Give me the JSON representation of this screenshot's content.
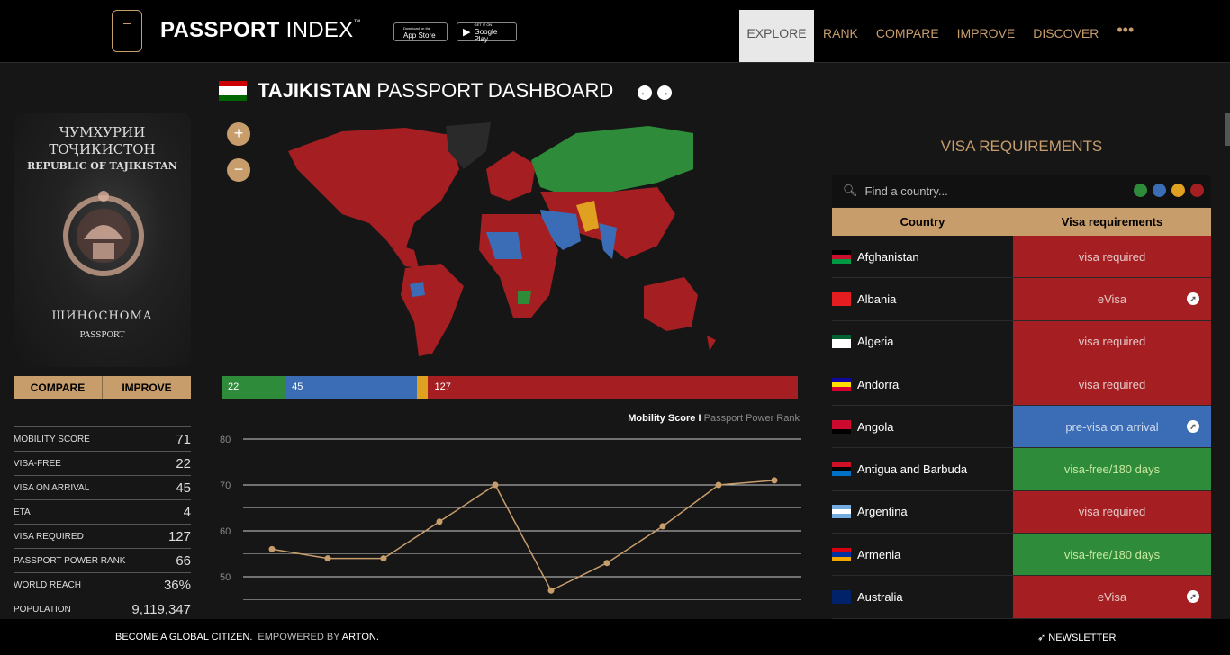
{
  "header": {
    "brand_bold": "PASSPORT",
    "brand_light": " INDEX",
    "brand_tm": "™",
    "app_store": "App Store",
    "app_store_small": "Download on the",
    "google_play": "Google Play",
    "google_play_small": "GET IT ON",
    "nav": [
      "EXPLORE",
      "RANK",
      "COMPARE",
      "IMPROVE",
      "DISCOVER",
      "•••"
    ]
  },
  "passport": {
    "cover_line1": "ЧУМХУРИИ",
    "cover_line2": "ТОҶИКИСТОН",
    "cover_line3": "REPUBLIC OF TAJIKISTAN",
    "cover_line4": "ШИНОСНОМА",
    "cover_line5": "PASSPORT",
    "compare_label": "COMPARE",
    "improve_label": "IMPROVE"
  },
  "stats": [
    {
      "label": "MOBILITY SCORE",
      "value": "71"
    },
    {
      "label": "VISA-FREE",
      "value": "22"
    },
    {
      "label": "VISA ON ARRIVAL",
      "value": "45"
    },
    {
      "label": "ETA",
      "value": "4"
    },
    {
      "label": "VISA REQUIRED",
      "value": "127"
    },
    {
      "label": "PASSPORT POWER RANK",
      "value": "66"
    },
    {
      "label": "WORLD REACH",
      "value": "36%"
    },
    {
      "label": "POPULATION",
      "value": "9,119,347"
    }
  ],
  "dashboard": {
    "country": "TAJIKISTAN",
    "title_rest": " PASSPORT DASHBOARD",
    "zoom_in": "+",
    "zoom_out": "−",
    "summary_bar": [
      {
        "value": 22,
        "color": "#2e8b3a"
      },
      {
        "value": 45,
        "color": "#3a6db5"
      },
      {
        "value": 4,
        "color": "#e0a020"
      },
      {
        "value": 127,
        "color": "#a51f22"
      }
    ],
    "legend_active": "Mobility Score I",
    "legend_inactive": "Passport Power Rank"
  },
  "chart_data": {
    "type": "line",
    "title": "",
    "xlabel": "",
    "ylabel": "",
    "ylim": [
      40,
      80
    ],
    "yticks": [
      80,
      70,
      60,
      50
    ],
    "series": [
      {
        "name": "Mobility Score",
        "values": [
          56,
          54,
          54,
          62,
          70,
          47,
          53,
          61,
          70,
          71
        ]
      }
    ],
    "grid": true
  },
  "visa": {
    "title": "VISA REQUIREMENTS",
    "search_placeholder": "Find a country...",
    "filter_colors": [
      "#2e8b3a",
      "#3a6db5",
      "#e0a020",
      "#a51f22"
    ],
    "col_country": "Country",
    "col_requirement": "Visa requirements",
    "rows": [
      {
        "country": "Afghanistan",
        "req": "visa required",
        "color": "#a51f22",
        "text_color": "#e6c9c9",
        "ext": false,
        "flag": [
          "#000000",
          "#c8102e",
          "#009a44"
        ]
      },
      {
        "country": "Albania",
        "req": "eVisa",
        "color": "#a51f22",
        "text_color": "#e6c9c9",
        "ext": true,
        "flag": [
          "#e41e20",
          "#e41e20",
          "#e41e20"
        ]
      },
      {
        "country": "Algeria",
        "req": "visa required",
        "color": "#a51f22",
        "text_color": "#e6c9c9",
        "ext": false,
        "flag": [
          "#006233",
          "#ffffff",
          "#ffffff"
        ]
      },
      {
        "country": "Andorra",
        "req": "visa required",
        "color": "#a51f22",
        "text_color": "#e6c9c9",
        "ext": false,
        "flag": [
          "#10069f",
          "#fedd00",
          "#d50032"
        ]
      },
      {
        "country": "Angola",
        "req": "pre-visa on arrival",
        "color": "#3a6db5",
        "text_color": "#cfdaf0",
        "ext": true,
        "flag": [
          "#cc092f",
          "#cc092f",
          "#000000"
        ]
      },
      {
        "country": "Antigua and Barbuda",
        "req": "visa-free/180 days",
        "color": "#2e8b3a",
        "text_color": "#c7e8a0",
        "ext": false,
        "flag": [
          "#ce1126",
          "#000000",
          "#0072c6"
        ]
      },
      {
        "country": "Argentina",
        "req": "visa required",
        "color": "#a51f22",
        "text_color": "#e6c9c9",
        "ext": false,
        "flag": [
          "#74acdf",
          "#ffffff",
          "#74acdf"
        ]
      },
      {
        "country": "Armenia",
        "req": "visa-free/180 days",
        "color": "#2e8b3a",
        "text_color": "#c7e8a0",
        "ext": false,
        "flag": [
          "#d90012",
          "#0033a0",
          "#f2a800"
        ]
      },
      {
        "country": "Australia",
        "req": "eVisa",
        "color": "#a51f22",
        "text_color": "#e6c9c9",
        "ext": true,
        "flag": [
          "#012169",
          "#012169",
          "#012169"
        ]
      }
    ]
  },
  "footer": {
    "tagline": "BECOME A GLOBAL CITIZEN.",
    "empowered": "EMPOWERED BY",
    "arton": "ARTON.",
    "newsletter": "NEWSLETTER"
  },
  "flag_tj": [
    "#cc0000",
    "#ffffff",
    "#006600"
  ]
}
